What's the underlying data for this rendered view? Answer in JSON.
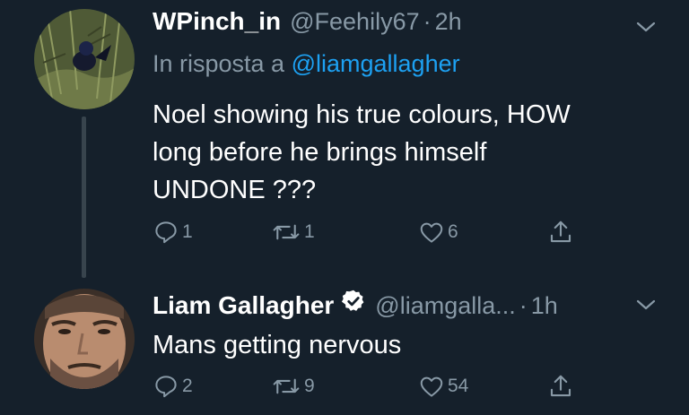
{
  "tweets": [
    {
      "display_name": "WPinch_in",
      "handle": "@Feehily67",
      "separator": "·",
      "time": "2h",
      "reply_prefix": "In risposta a",
      "reply_mention": "@liamgallagher",
      "text_lines": [
        "Noel showing his true colours, HOW",
        "long before he brings himself",
        "UNDONE ???"
      ],
      "counts": {
        "replies": "1",
        "retweets": "1",
        "likes": "6"
      }
    },
    {
      "display_name": "Liam Gallagher",
      "handle": "@liamgalla...",
      "separator": "·",
      "time": "1h",
      "verified": true,
      "text_lines": [
        "Mans getting nervous"
      ],
      "counts": {
        "replies": "2",
        "retweets": "9",
        "likes": "54"
      }
    }
  ],
  "icons": {
    "more": "chevron-down-icon",
    "reply": "reply-icon",
    "retweet": "retweet-icon",
    "like": "heart-icon",
    "share": "share-icon",
    "verified": "verified-badge-icon"
  },
  "colors": {
    "background": "#15202b",
    "primary_text": "#ffffff",
    "secondary_text": "#8899a6",
    "link": "#1da1f2",
    "thread_line": "#38444d"
  }
}
